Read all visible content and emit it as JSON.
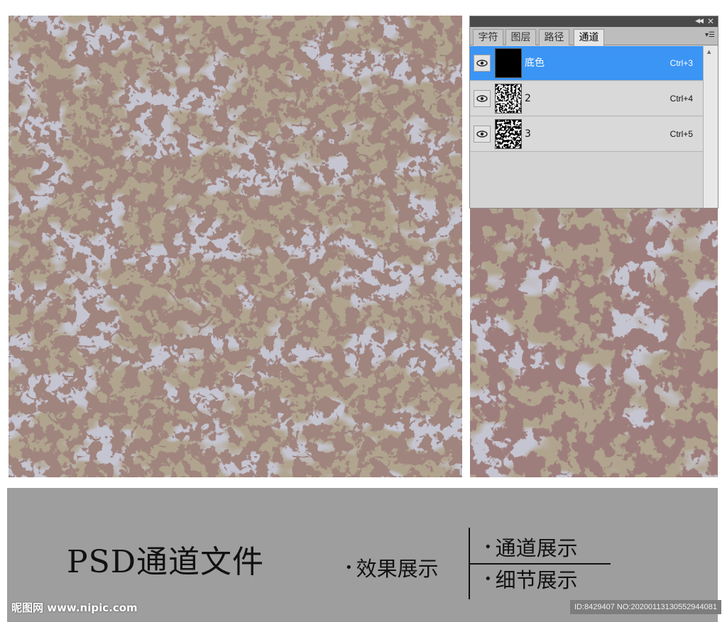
{
  "panel": {
    "tabs": [
      {
        "label": "字符",
        "active": false
      },
      {
        "label": "图层",
        "active": false
      },
      {
        "label": "路径",
        "active": false
      },
      {
        "label": "通道",
        "active": true
      }
    ],
    "channels": [
      {
        "name": "底色",
        "shortcut": "Ctrl+3",
        "selected": true,
        "thumbnail": "solid-black"
      },
      {
        "name": "2",
        "shortcut": "Ctrl+4",
        "selected": false,
        "thumbnail": "speckle"
      },
      {
        "name": "3",
        "shortcut": "Ctrl+5",
        "selected": false,
        "thumbnail": "speckle"
      }
    ],
    "icons": {
      "collapse": "double-chevron-left-icon",
      "close": "close-icon",
      "menu": "panel-menu-icon",
      "eye": "eye-icon"
    }
  },
  "banner": {
    "title": "PSD通道文件",
    "effect_label": "效果展示",
    "channel_label": "通道展示",
    "detail_label": "细节展示",
    "bullet": "•"
  },
  "watermark": {
    "logo_text": "昵图网 www.nipic.com",
    "id_text": "ID:8429407 NO:20200113130552944081"
  },
  "colors": {
    "texture_base": "#b0a48e",
    "texture_crack": "#5a3a36",
    "texture_overlay": "#8e8ea2",
    "selection": "#3b95f5",
    "banner_bg": "#9e9e9e"
  }
}
